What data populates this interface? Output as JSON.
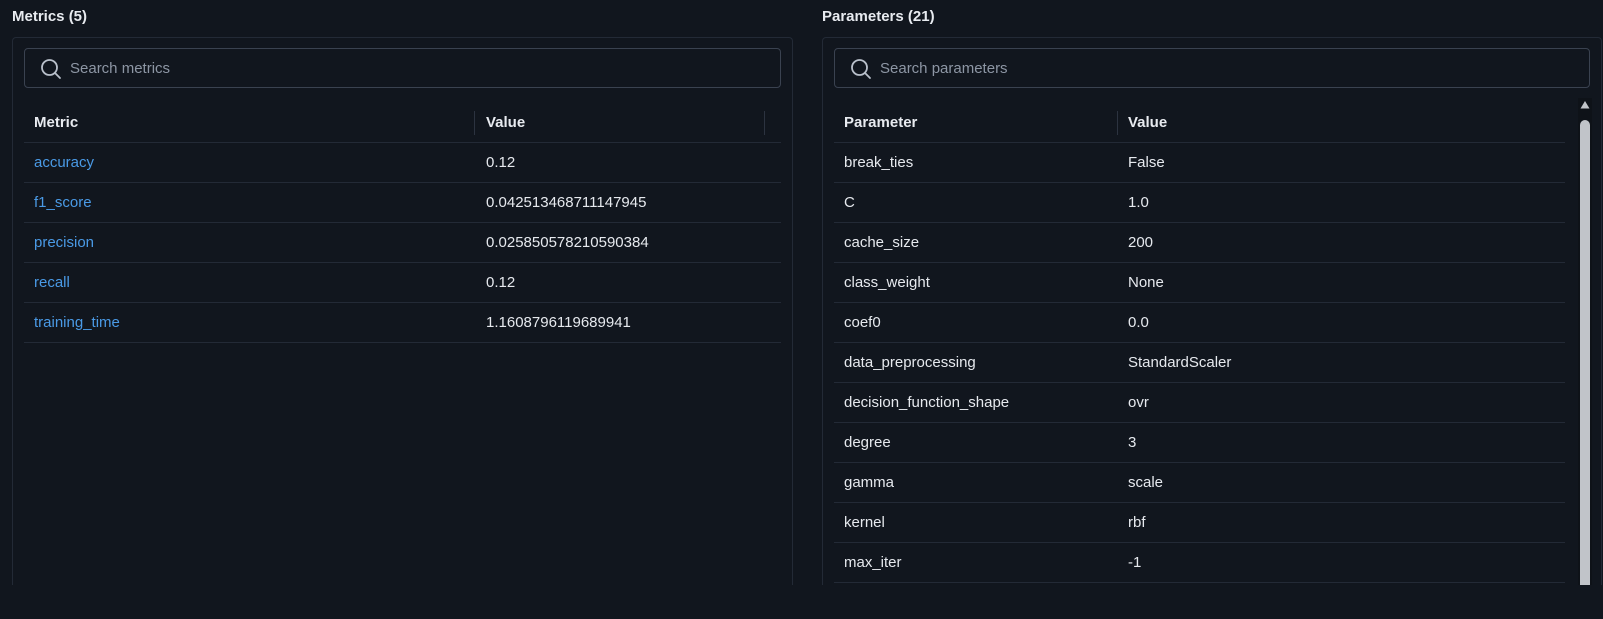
{
  "metrics": {
    "title": "Metrics (5)",
    "search_placeholder": "Search metrics",
    "columns": [
      "Metric",
      "Value"
    ],
    "rows": [
      {
        "name": "accuracy",
        "value": "0.12"
      },
      {
        "name": "f1_score",
        "value": "0.042513468711147945"
      },
      {
        "name": "precision",
        "value": "0.025850578210590384"
      },
      {
        "name": "recall",
        "value": "0.12"
      },
      {
        "name": "training_time",
        "value": "1.1608796119689941"
      }
    ]
  },
  "parameters": {
    "title": "Parameters (21)",
    "search_placeholder": "Search parameters",
    "columns": [
      "Parameter",
      "Value"
    ],
    "rows": [
      {
        "name": "break_ties",
        "value": "False"
      },
      {
        "name": "C",
        "value": "1.0"
      },
      {
        "name": "cache_size",
        "value": "200"
      },
      {
        "name": "class_weight",
        "value": "None"
      },
      {
        "name": "coef0",
        "value": "0.0"
      },
      {
        "name": "data_preprocessing",
        "value": "StandardScaler"
      },
      {
        "name": "decision_function_shape",
        "value": "ovr"
      },
      {
        "name": "degree",
        "value": "3"
      },
      {
        "name": "gamma",
        "value": "scale"
      },
      {
        "name": "kernel",
        "value": "rbf"
      },
      {
        "name": "max_iter",
        "value": "-1"
      }
    ]
  },
  "colors": {
    "background": "#11161e",
    "link": "#4a9ae6",
    "border": "#232a36"
  },
  "icons": {
    "search": "search-icon",
    "scroll_up": "triangle-up-icon"
  }
}
